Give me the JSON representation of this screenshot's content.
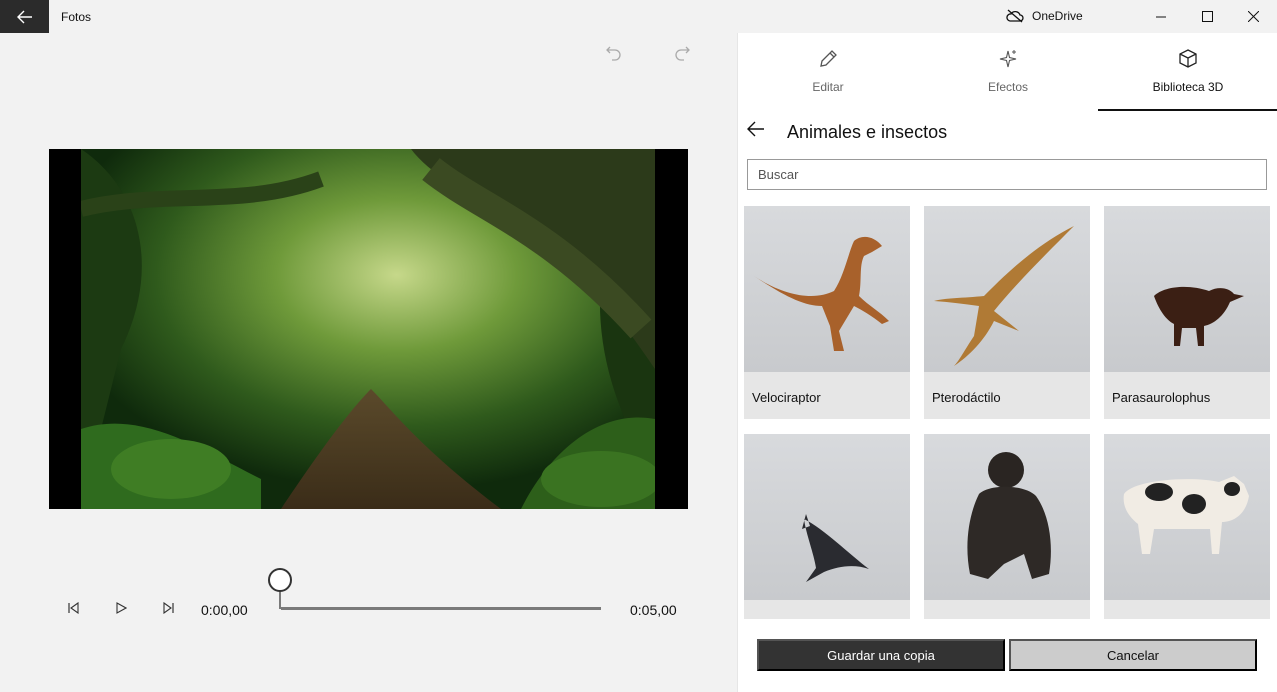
{
  "window": {
    "title": "Fotos",
    "onedrive_label": "OneDrive"
  },
  "tabs": [
    {
      "label": "Editar",
      "icon": "pencil-icon"
    },
    {
      "label": "Efectos",
      "icon": "sparkle-icon"
    },
    {
      "label": "Biblioteca 3D",
      "icon": "3d-cube-icon",
      "active": true
    }
  ],
  "library": {
    "title": "Animales e insectos",
    "search_placeholder": "Buscar",
    "items": [
      {
        "label": "Velociraptor"
      },
      {
        "label": "Pterodáctilo"
      },
      {
        "label": "Parasaurolophus"
      },
      {
        "label": ""
      },
      {
        "label": ""
      },
      {
        "label": ""
      }
    ]
  },
  "timeline": {
    "current_time": "0:00,00",
    "end_time": "0:05,00",
    "progress": 0
  },
  "actions": {
    "save_label": "Guardar una copia",
    "cancel_label": "Cancelar"
  },
  "colors": {
    "titlebar_back": "#2b2b2b",
    "primary_button": "#333333",
    "secondary_button": "#cccccc"
  }
}
